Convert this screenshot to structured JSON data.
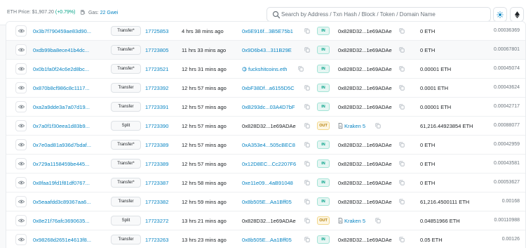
{
  "header": {
    "eth_price_label": "ETH Price: $1,907.20",
    "eth_price_change": "(+0.79%)",
    "gas_label": "Gas:",
    "gas_value": "22 Gwei",
    "search_placeholder": "Search by Address / Txn Hash / Block / Token / Domain Name"
  },
  "colors": {
    "link": "#0784c3",
    "in_badge": "#00a186",
    "out_badge": "#b47d00",
    "positive_change": "#00a186"
  },
  "transactions": [
    {
      "hash": "0x3b7f790459ae83d90...",
      "method": "Transfer*",
      "block": "17725853",
      "age": "4 hrs 38 mins ago",
      "from": "0x6E916f...3B5E75b1",
      "from_style": "link",
      "direction": "IN",
      "to": "0x828D32...1e69ADAe",
      "to_style": "plain",
      "amount": "0 ETH",
      "fee": "0.00036369"
    },
    {
      "hash": "0xdb99ba8ece41b4dc...",
      "method": "Transfer*",
      "block": "17723805",
      "age": "11 hrs 33 mins ago",
      "from": "0x9D6b43...311B29E",
      "from_style": "link",
      "direction": "IN",
      "to": "0x828D32...1e69ADAe",
      "to_style": "plain",
      "amount": "0 ETH",
      "fee": "0.00067801"
    },
    {
      "hash": "0x0b1fa0f24c6e2d8bc...",
      "method": "Transfer*",
      "block": "17723521",
      "age": "12 hrs 31 mins ago",
      "from": "fuckshitcoins.eth",
      "from_style": "ens",
      "direction": "IN",
      "to": "0x828D32...1e69ADAe",
      "to_style": "plain",
      "amount": "0.00001 ETH",
      "fee": "0.00045074"
    },
    {
      "hash": "0x870b8cf986c8c1117...",
      "method": "Transfer",
      "block": "17723392",
      "age": "12 hrs 57 mins ago",
      "from": "0xbF38Df...a6155D5C",
      "from_style": "link",
      "direction": "IN",
      "to": "0x828D32...1e69ADAe",
      "to_style": "plain",
      "amount": "0.0001 ETH",
      "fee": "0.00043624"
    },
    {
      "hash": "0xa2a9dde3a7a07d19...",
      "method": "Transfer",
      "block": "17723391",
      "age": "12 hrs 57 mins ago",
      "from": "0xB293dc...03A4D7bF",
      "from_style": "link",
      "direction": "IN",
      "to": "0x828D32...1e69ADAe",
      "to_style": "plain",
      "amount": "0.00001 ETH",
      "fee": "0.00042717"
    },
    {
      "hash": "0x7a0f1f30eea1d83b9...",
      "method": "Split",
      "block": "17723390",
      "age": "12 hrs 57 mins ago",
      "from": "0x828D32...1e69ADAe",
      "from_style": "plain",
      "direction": "OUT",
      "to": "Kraken 5",
      "to_style": "kraken",
      "amount": "61,216.44923854 ETH",
      "fee": "0.00088077"
    },
    {
      "hash": "0x7e0ad81a936d7bdaf...",
      "method": "Transfer*",
      "block": "17723389",
      "age": "12 hrs 57 mins ago",
      "from": "0xA353e4...505cBEC8",
      "from_style": "link",
      "direction": "IN",
      "to": "0x828D32...1e69ADAe",
      "to_style": "plain",
      "amount": "0 ETH",
      "fee": "0.00042959"
    },
    {
      "hash": "0x729a1158459be445...",
      "method": "Transfer*",
      "block": "17723389",
      "age": "12 hrs 57 mins ago",
      "from": "0x12D8EC...Cc2207F6",
      "from_style": "link",
      "direction": "IN",
      "to": "0x828D32...1e69ADAe",
      "to_style": "plain",
      "amount": "0 ETH",
      "fee": "0.00043581"
    },
    {
      "hash": "0x8faa19fd1f81df0767...",
      "method": "Transfer*",
      "block": "17723387",
      "age": "12 hrs 58 mins ago",
      "from": "0xe11e09...4aB91048",
      "from_style": "link",
      "direction": "IN",
      "to": "0x828D32...1e69ADAe",
      "to_style": "plain",
      "amount": "0 ETH",
      "fee": "0.00053627"
    },
    {
      "hash": "0x5eaafdd3c89367aa6...",
      "method": "Transfer",
      "block": "17723382",
      "age": "12 hrs 59 mins ago",
      "from": "0x8b505E...Aa1Bff05",
      "from_style": "link",
      "direction": "IN",
      "to": "0x828D32...1e69ADAe",
      "to_style": "plain",
      "amount": "61,216.4500111 ETH",
      "fee": "0.00168"
    },
    {
      "hash": "0x8e21f76afc3690635...",
      "method": "Split",
      "block": "17723272",
      "age": "13 hrs 21 mins ago",
      "from": "0x828D32...1e69ADAe",
      "from_style": "plain",
      "direction": "OUT",
      "to": "Kraken 5",
      "to_style": "kraken",
      "amount": "0.04851966 ETH",
      "fee": "0.00110988"
    },
    {
      "hash": "0x98268d2651e4613f8...",
      "method": "Transfer",
      "block": "17723263",
      "age": "13 hrs 23 mins ago",
      "from": "0x8b505E...Aa1Bff05",
      "from_style": "link",
      "direction": "IN",
      "to": "0x828D32...1e69ADAe",
      "to_style": "plain",
      "amount": "0.05 ETH",
      "fee": "0.00126"
    }
  ]
}
